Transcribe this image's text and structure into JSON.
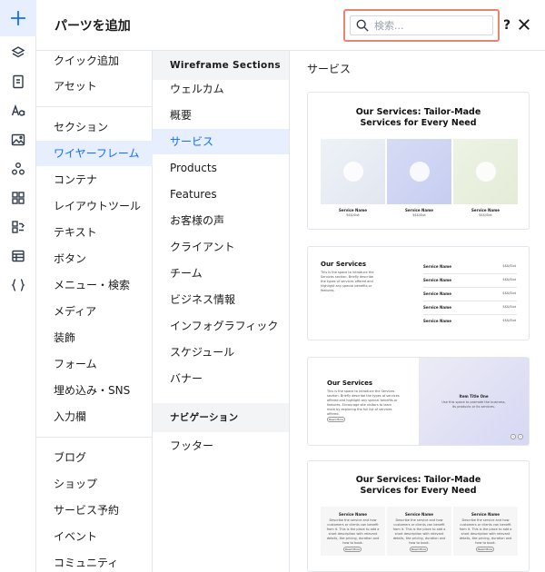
{
  "header": {
    "title": "パーツを追加",
    "search_placeholder": "検索...",
    "help_label": "?"
  },
  "rail": {
    "icons": [
      "plus-icon",
      "layers-icon",
      "page-icon",
      "text-icon",
      "image-icon",
      "apps-icon",
      "grid-icon",
      "component-icon",
      "table-icon",
      "code-icon"
    ]
  },
  "categories": {
    "group1": [
      "クイック追加",
      "アセット"
    ],
    "group2": [
      "セクション",
      "ワイヤーフレーム",
      "コンテナ",
      "レイアウトツール",
      "テキスト",
      "ボタン",
      "メニュー・検索",
      "メディア",
      "装飾",
      "フォーム",
      "埋め込み・SNS",
      "入力欄"
    ],
    "group3": [
      "ブログ",
      "ショップ",
      "サービス予約",
      "イベント",
      "コミュニティ"
    ],
    "selected": "ワイヤーフレーム"
  },
  "subcategories": {
    "heading1": "Wireframe Sections",
    "items1": [
      "ウェルカム",
      "概要",
      "サービス",
      "Products",
      "Features",
      "お客様の声",
      "クライアント",
      "チーム",
      "ビジネス情報",
      "インフォグラフィック",
      "スケジュール",
      "バナー"
    ],
    "heading2": "ナビゲーション",
    "items2": [
      "フッター"
    ],
    "selected": "サービス"
  },
  "preview": {
    "title": "サービス",
    "card1": {
      "heading_line1": "Our Services: Tailor-Made",
      "heading_line2": "Services for Every Need",
      "service_name": "Service Name",
      "price": "$$$/Slot"
    },
    "card2": {
      "heading": "Our Services",
      "desc": "This is the space to introduce the Services section. Briefly describe the types of services offered and highlight any special benefits or features.",
      "rows": [
        "Service Name",
        "Service Name",
        "Service Name",
        "Service Name",
        "Service Name"
      ],
      "price": "$$$/Slot"
    },
    "card3": {
      "heading": "Our Services",
      "desc": "This is the space to introduce the Services section. Briefly describe the types of services offered and highlight any special benefits or features. Encourage site visitors to learn more by exploring the full list of services offered.",
      "button": "Read More",
      "item_title": "Item Title One",
      "item_desc": "Use this space to promote the business, its products or its services.",
      "prev": "‹",
      "next": "›"
    },
    "card4": {
      "heading_line1": "Our Services: Tailor-Made",
      "heading_line2": "Services for Every Need",
      "service_name": "Service Name",
      "desc": "Describe the service and how customers or clients can benefit from it. This is the place to add a short description with relevant details, like pricing, duration and how to book.",
      "button": "Read More"
    }
  }
}
